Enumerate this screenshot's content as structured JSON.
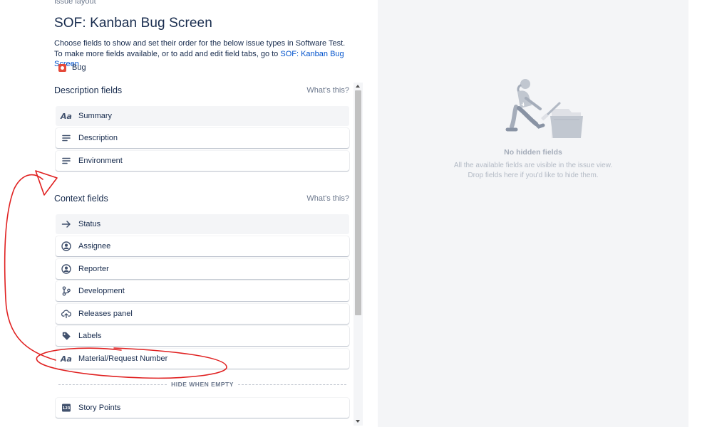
{
  "breadcrumb": "Issue layout",
  "title": "SOF: Kanban Bug Screen",
  "description": {
    "text": "Choose fields to show and set their order for the below issue types in Software Test. To make more fields available, or to add and edit field tabs, go to ",
    "link": "SOF: Kanban Bug Screen",
    "end": "."
  },
  "issue_type": {
    "label": "Bug",
    "icon": "bug-icon",
    "color": "#e5493a"
  },
  "description_section": {
    "title": "Description fields",
    "help": "What's this?",
    "fields": [
      {
        "label": "Summary",
        "icon": "text-aa-icon"
      },
      {
        "label": "Description",
        "icon": "paragraph-icon"
      },
      {
        "label": "Environment",
        "icon": "paragraph-icon"
      }
    ]
  },
  "context_section": {
    "title": "Context fields",
    "help": "What's this?",
    "fields": [
      {
        "label": "Status",
        "icon": "arrow-right-icon"
      },
      {
        "label": "Assignee",
        "icon": "person-circle-icon"
      },
      {
        "label": "Reporter",
        "icon": "person-circle-icon"
      },
      {
        "label": "Development",
        "icon": "branch-icon"
      },
      {
        "label": "Releases panel",
        "icon": "cloud-upload-icon"
      },
      {
        "label": "Labels",
        "icon": "tag-icon"
      },
      {
        "label": "Material/Request Number",
        "icon": "text-aa-icon"
      }
    ],
    "divider": "HIDE WHEN EMPTY",
    "hidden_when_empty": [
      {
        "label": "Story Points",
        "icon": "number-123-icon"
      }
    ]
  },
  "hidden_panel": {
    "title": "No hidden fields",
    "line1": "All the available fields are visible in the issue view.",
    "line2": "Drop fields here if you'd like to hide them."
  },
  "colors": {
    "link": "#0052cc",
    "text": "#172b4d",
    "panel_bg": "#f4f5f7",
    "annotation": "#e02020"
  }
}
